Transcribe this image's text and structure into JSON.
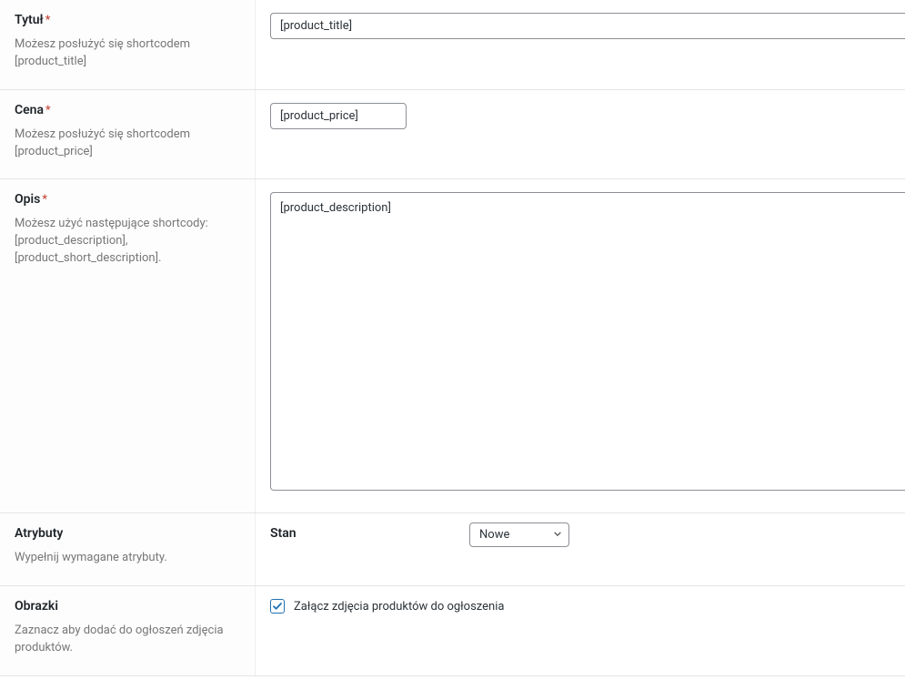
{
  "title": {
    "label": "Tytuł",
    "required": "*",
    "desc": "Możesz posłużyć się shortcodem [product_title]",
    "value": "[product_title]"
  },
  "price": {
    "label": "Cena",
    "required": "*",
    "desc": "Możesz posłużyć się shortcodem [product_price]",
    "value": "[product_price]"
  },
  "description": {
    "label": "Opis",
    "required": "*",
    "desc": "Możesz użyć następujące shortcody: [product_description], [product_short_description].",
    "value": "[product_description]"
  },
  "attributes": {
    "label": "Atrybuty",
    "desc": "Wypełnij wymagane atrybuty.",
    "attr_name": "Stan",
    "selected": "Nowe"
  },
  "images": {
    "label": "Obrazki",
    "desc": "Zaznacz aby dodać do ogłoszeń zdjęcia produktów.",
    "checkbox_label": "Załącz zdjęcia produktów do ogłoszenia"
  }
}
